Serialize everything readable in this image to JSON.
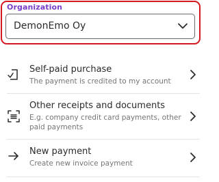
{
  "organization": {
    "label": "Organization",
    "selected": "DemonEmo Oy",
    "label_color": "#7a3fc8",
    "highlight_color": "#d4161e",
    "chevron_icon": "chevron-down-icon"
  },
  "menu": {
    "items": [
      {
        "title": "Self-paid purchase",
        "description": "The payment is credited to my account",
        "icon": "receipt-arrow-icon"
      },
      {
        "title": "Other receipts and documents",
        "description": "E.g. company credit card payments, other paid payments",
        "icon": "document-scan-icon"
      },
      {
        "title": "New payment",
        "description": "Create new invoice payment",
        "icon": "arrow-right-icon"
      }
    ],
    "chevron_icon": "chevron-right-icon"
  }
}
